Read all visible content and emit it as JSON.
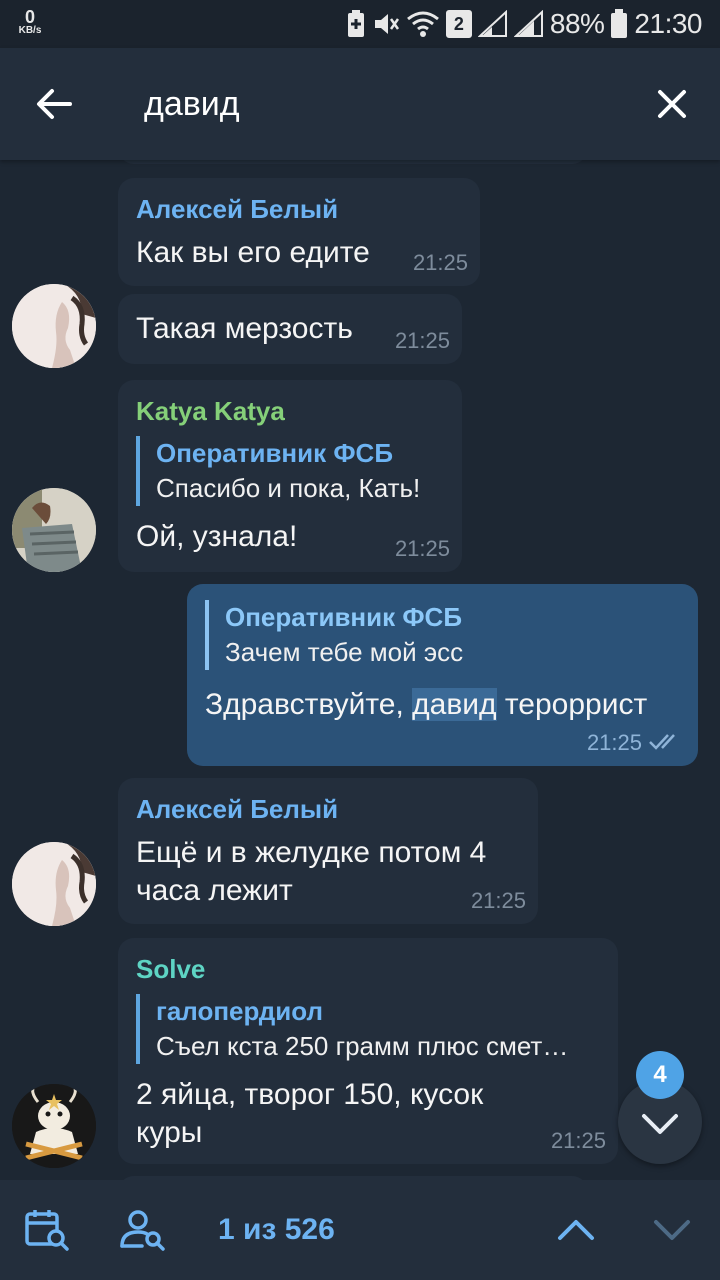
{
  "status_bar": {
    "speed_value": "0",
    "speed_unit": "KB/s",
    "sim_number": "2",
    "battery": "88%",
    "time": "21:30"
  },
  "search": {
    "query": "давид"
  },
  "messages": [
    {
      "sender": "Алексей Белый",
      "text": "Как вы его едите",
      "time": "21:25"
    },
    {
      "text": "Такая мерзость",
      "time": "21:25"
    },
    {
      "sender": "Katya Katya",
      "reply_name": "Оперативник ФСБ",
      "reply_text": "Спасибо и пока, Кать!",
      "text": "Ой, узнала!",
      "time": "21:25"
    },
    {
      "outgoing": true,
      "reply_name": "Оперативник ФСБ",
      "reply_text": "Зачем тебе мой эсс",
      "text_before": "Здравствуйте, ",
      "text_highlight": "давид",
      "text_after": " тероррист",
      "time": "21:25"
    },
    {
      "sender": "Алексей Белый",
      "text_line1": "Ещё и в желудке потом 4",
      "text_line2": "часа лежит",
      "time": "21:25"
    },
    {
      "sender": "Solve",
      "reply_name": "галопердиол",
      "reply_text": "Съел кста 250 грамм плюс смет…",
      "text_line1": "2 яйца, творог 150, кусок",
      "text_line2": "куры",
      "time": "21:25"
    }
  ],
  "scroll_badge": "4",
  "bottom": {
    "counter": "1 из 526"
  },
  "colors": {
    "background": "#1d2733",
    "bubble_in": "#232e3c",
    "bubble_out": "#2b5278",
    "accent": "#6db3f2",
    "katya_name": "#85d079",
    "solve_name": "#5ed4c4"
  }
}
